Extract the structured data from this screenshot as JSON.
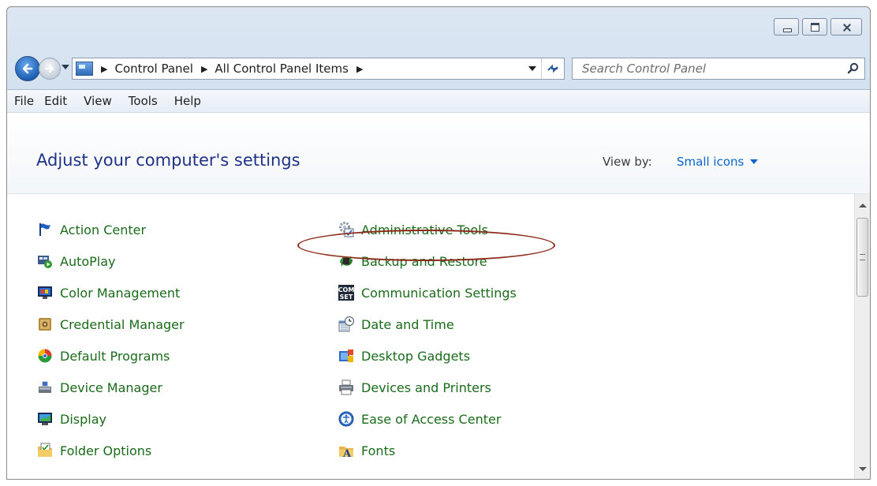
{
  "window": {
    "colors": {
      "link_green": "#1a6b1a",
      "title_blue": "#1e3287",
      "accent_blue": "#0a66cc",
      "highlight": "#8b2a1a"
    }
  },
  "address": {
    "crumbs": [
      "Control Panel",
      "All Control Panel Items"
    ]
  },
  "search": {
    "placeholder": "Search Control Panel"
  },
  "menu": [
    "File",
    "Edit",
    "View",
    "Tools",
    "Help"
  ],
  "page": {
    "title": "Adjust your computer's settings",
    "view_by_label": "View by:",
    "view_by_value": "Small icons"
  },
  "items": {
    "column1": [
      {
        "label": "Action Center",
        "icon": "flag-icon"
      },
      {
        "label": "AutoPlay",
        "icon": "autoplay-icon"
      },
      {
        "label": "Color Management",
        "icon": "color-management-icon"
      },
      {
        "label": "Credential Manager",
        "icon": "credential-manager-icon"
      },
      {
        "label": "Default Programs",
        "icon": "default-programs-icon"
      },
      {
        "label": "Device Manager",
        "icon": "device-manager-icon"
      },
      {
        "label": "Display",
        "icon": "display-icon"
      },
      {
        "label": "Folder Options",
        "icon": "folder-options-icon"
      }
    ],
    "column2": [
      {
        "label": "Administrative Tools",
        "icon": "administrative-tools-icon"
      },
      {
        "label": "Backup and Restore",
        "icon": "backup-restore-icon"
      },
      {
        "label": "Communication Settings",
        "icon": "communication-settings-icon"
      },
      {
        "label": "Date and Time",
        "icon": "date-time-icon"
      },
      {
        "label": "Desktop Gadgets",
        "icon": "desktop-gadgets-icon"
      },
      {
        "label": "Devices and Printers",
        "icon": "devices-printers-icon"
      },
      {
        "label": "Ease of Access Center",
        "icon": "ease-of-access-icon"
      },
      {
        "label": "Fonts",
        "icon": "fonts-icon"
      }
    ]
  }
}
